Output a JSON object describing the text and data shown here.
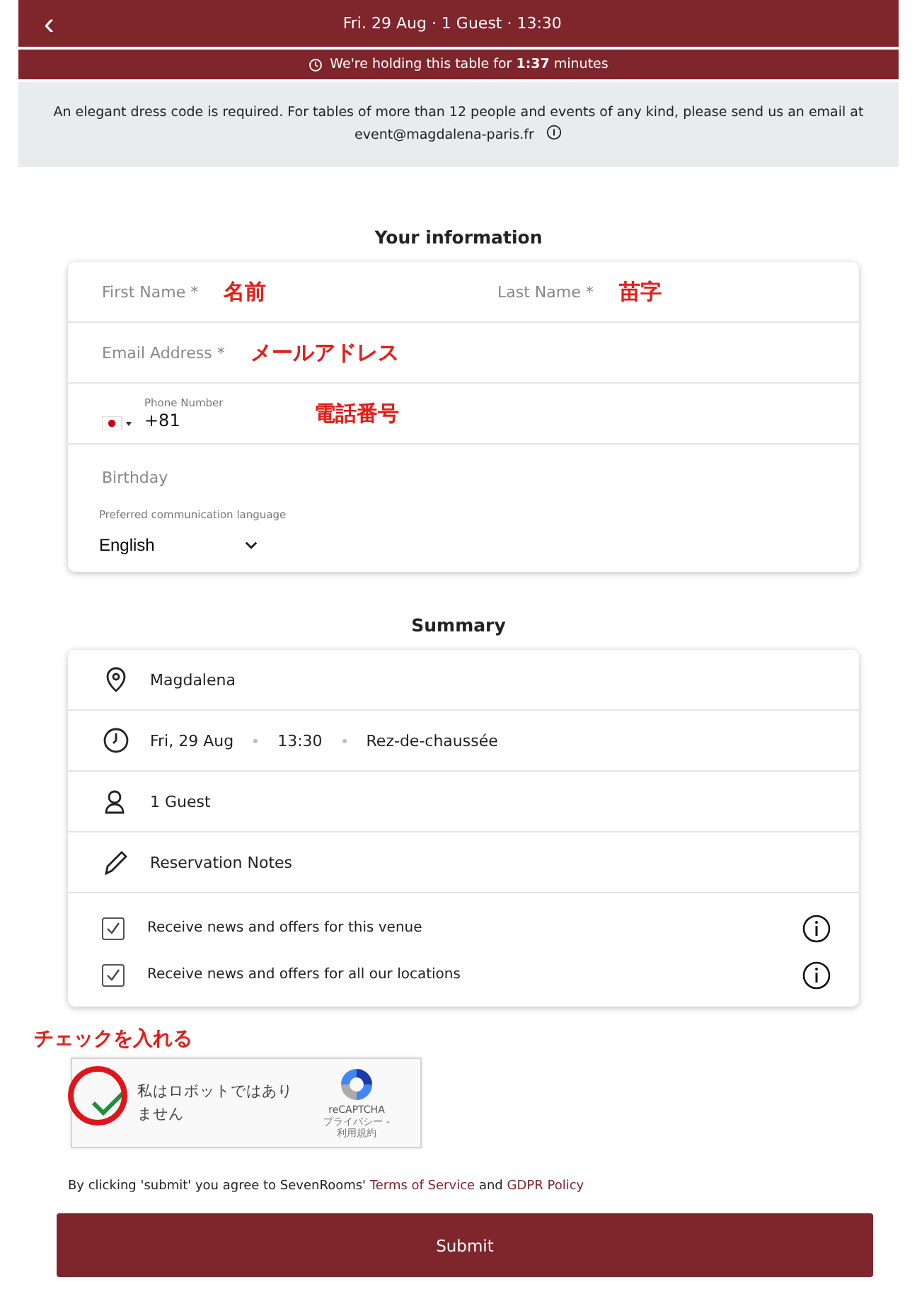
{
  "header": {
    "back": "‹",
    "title": "Fri. 29 Aug · 1 Guest · 13:30"
  },
  "hold_banner": {
    "text": "We're holding this table for **1:37** minutes"
  },
  "notice": {
    "text": "An elegant dress code is required. For tables of more than 12 people and events of any kind, please send us an email at",
    "email": "event@magdalena-paris.fr"
  },
  "your_information": {
    "title": "Your information",
    "first_name": {
      "placeholder": "First Name *",
      "annotation": "名前"
    },
    "last_name": {
      "placeholder": "Last Name *",
      "annotation": "苗字"
    },
    "email": {
      "placeholder": "Email Address *",
      "annotation": "メールアドレス"
    },
    "phone": {
      "label": "Phone Number",
      "value": "+81",
      "annotation": "電話番号"
    },
    "birthday": {
      "placeholder": "Birthday"
    },
    "language": {
      "label": "Preferred communication language",
      "value": "English"
    }
  },
  "summary": {
    "title": "Summary",
    "rows": [
      {
        "kind": "location",
        "parts": [
          "Magdalena"
        ]
      },
      {
        "kind": "time",
        "parts": [
          "Fri, 29 Aug",
          "13:30",
          "Rez-de-chaussée"
        ]
      },
      {
        "kind": "guests",
        "parts": [
          "1 Guest"
        ]
      },
      {
        "kind": "notes",
        "parts": [
          "Reservation Notes"
        ]
      }
    ],
    "options": [
      {
        "label": "Receive news and offers for this venue",
        "checked": true
      },
      {
        "label": "Receive news and offers for all our locations",
        "checked": true
      }
    ]
  },
  "captcha": {
    "annotation": "チェックを入れる",
    "checked": true,
    "text": "私はロボットではありません",
    "brand": "reCAPTCHA",
    "links": "プライバシー - 利用規約"
  },
  "terms": {
    "prefix": "By clicking 'submit' you agree to SevenRooms'",
    "terms_link": "Terms of Service",
    "and": "and",
    "gdpr_link": "GDPR Policy"
  },
  "submit": "Submit"
}
